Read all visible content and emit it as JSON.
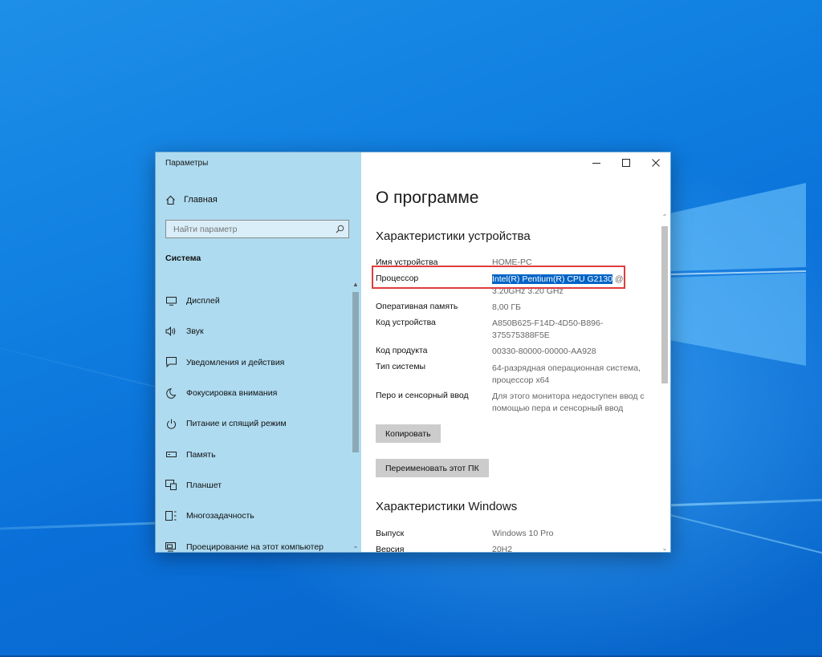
{
  "window": {
    "title": "Параметры"
  },
  "sidebar": {
    "home_label": "Главная",
    "search_placeholder": "Найти параметр",
    "section_label": "Система",
    "items": [
      {
        "label": "Дисплей",
        "icon": "display-icon"
      },
      {
        "label": "Звук",
        "icon": "sound-icon"
      },
      {
        "label": "Уведомления и действия",
        "icon": "notifications-icon"
      },
      {
        "label": "Фокусировка внимания",
        "icon": "focus-moon-icon"
      },
      {
        "label": "Питание и спящий режим",
        "icon": "power-icon"
      },
      {
        "label": "Память",
        "icon": "storage-icon"
      },
      {
        "label": "Планшет",
        "icon": "tablet-icon"
      },
      {
        "label": "Многозадачность",
        "icon": "multitasking-icon"
      },
      {
        "label": "Проецирование на этот компьютер",
        "icon": "projecting-icon"
      }
    ]
  },
  "main": {
    "title": "О программе",
    "device_heading": "Характеристики устройства",
    "specs": {
      "device_name_label": "Имя устройства",
      "device_name_value": "HOME-PC",
      "processor_label": "Процессор",
      "processor_value_selected": "Intel(R) Pentium(R) CPU G2130",
      "processor_value_rest": " @",
      "processor_value_line2": "3.20GHz   3.20 GHz",
      "ram_label": "Оперативная память",
      "ram_value": "8,00 ГБ",
      "device_id_label": "Код устройства",
      "device_id_value": "A850B625-F14D-4D50-B896-375575388F5E",
      "product_id_label": "Код продукта",
      "product_id_value": "00330-80000-00000-AA928",
      "system_type_label": "Тип системы",
      "system_type_value": "64-разрядная операционная система, процессор x64",
      "pen_label": "Перо и сенсорный ввод",
      "pen_value": "Для этого монитора недоступен ввод с помощью пера и сенсорный ввод"
    },
    "copy_button": "Копировать",
    "rename_button": "Переименовать этот ПК",
    "windows_heading": "Характеристики Windows",
    "edition_label": "Выпуск",
    "edition_value": "Windows 10 Pro",
    "version_label": "Версия",
    "version_value": "20H2"
  },
  "colors": {
    "sidebar_bg": "#aedbf0",
    "selection": "#0063c6",
    "highlight_box": "#e03c3c"
  }
}
